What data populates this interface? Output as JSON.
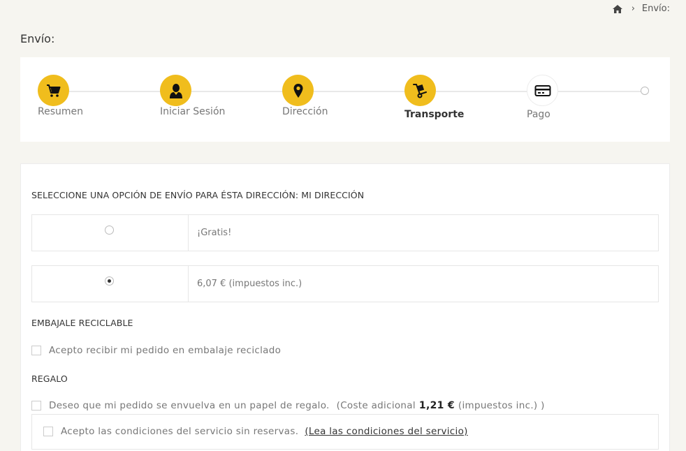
{
  "breadcrumb": {
    "home_icon": "home-icon",
    "separator": "›",
    "current": "Envío:"
  },
  "page_title": "Envío:",
  "steps": [
    {
      "label": "Resumen",
      "icon": "cart-icon",
      "state": "done"
    },
    {
      "label": "Iniciar Sesión",
      "icon": "user-icon",
      "state": "done"
    },
    {
      "label": "Dirección",
      "icon": "map-pin-icon",
      "state": "done"
    },
    {
      "label": "Transporte",
      "icon": "hand-truck-icon",
      "state": "current"
    },
    {
      "label": "Pago",
      "icon": "credit-card-icon",
      "state": "todo"
    }
  ],
  "shipping": {
    "title": "SELECCIONE UNA OPCIÓN DE ENVÍO PARA ÉSTA DIRECCIÓN: MI DIRECCIÓN",
    "options": [
      {
        "label": "¡Gratis!",
        "selected": false
      },
      {
        "label": "6,07 € (impuestos inc.)",
        "selected": true
      }
    ]
  },
  "recycle": {
    "title": "EMBAJALE RECICLABLE",
    "checkbox_label": "Acepto recibir mi pedido en embalaje reciclado",
    "checked": false
  },
  "gift": {
    "title": "REGALO",
    "checkbox_label": "Deseo que mi pedido se envuelva en un papel de regalo.",
    "cost_prefix": "(Coste adicional",
    "cost_value": "1,21 €",
    "cost_suffix": "(impuestos inc.) )",
    "checked": false
  },
  "terms": {
    "checkbox_label": "Acepto las condiciones del servicio sin reservas.",
    "link_label": "(Lea las condiciones del servicio)",
    "checked": false
  },
  "colors": {
    "accent": "#f0bd1d",
    "background": "#f6f5f0"
  }
}
